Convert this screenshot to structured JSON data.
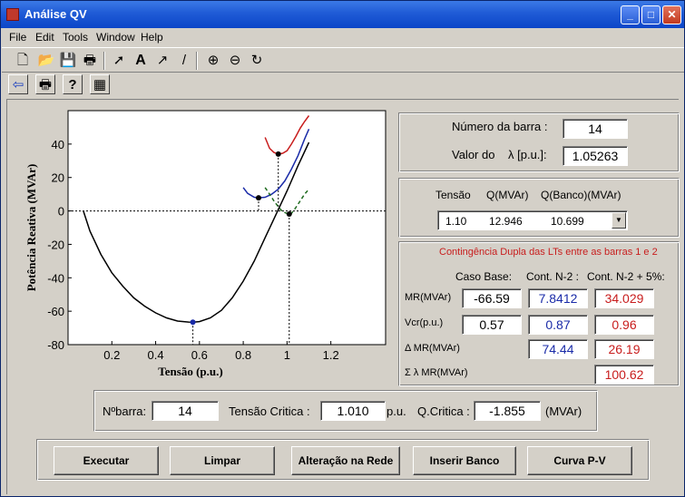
{
  "window": {
    "title": "Análise QV",
    "controls": {
      "minimize": "_",
      "maximize": "□",
      "close": "✕"
    }
  },
  "menu": [
    "File",
    "Edit",
    "Tools",
    "Window",
    "Help"
  ],
  "toolbar1": [
    "new-file-icon",
    "open-file-icon",
    "save-icon",
    "print-icon",
    "pointer-icon",
    "text-icon",
    "arrow-icon",
    "line-icon",
    "zoom-in-icon",
    "zoom-out-icon",
    "rotate-icon"
  ],
  "toolbar2": [
    "back-arrow-icon",
    "print-icon",
    "help-icon",
    "calculator-icon"
  ],
  "chart_data": {
    "type": "line",
    "xlabel": "Tensão (p.u.)",
    "ylabel": "Potência Reativa (MVAr)",
    "xlim": [
      0,
      1.45
    ],
    "ylim": [
      -80,
      60
    ],
    "xticks": [
      "0.2",
      "0.4",
      "0.6",
      "0.8",
      "1",
      "1.2"
    ],
    "yticks": [
      "-80",
      "-60",
      "-40",
      "-20",
      "0",
      "20",
      "40"
    ],
    "grid": false,
    "series": [
      {
        "color": "#000000",
        "x": [
          0.07,
          0.1,
          0.15,
          0.2,
          0.25,
          0.3,
          0.35,
          0.4,
          0.45,
          0.5,
          0.55,
          0.57,
          0.6,
          0.65,
          0.7,
          0.75,
          0.8,
          0.85,
          0.9,
          0.95,
          1.0,
          1.05,
          1.1
        ],
        "y": [
          0,
          -12,
          -26,
          -37,
          -45,
          -52,
          -57,
          -61,
          -64,
          -65.9,
          -66.5,
          -66.59,
          -66.2,
          -64,
          -59.5,
          -52,
          -42,
          -30,
          -16,
          -2,
          12,
          27,
          41
        ]
      },
      {
        "color": "#c81d1d",
        "x": [
          0.9,
          0.92,
          0.94,
          0.96,
          0.98,
          1.0,
          1.02,
          1.04,
          1.06,
          1.08,
          1.1
        ],
        "y": [
          44,
          37.5,
          35,
          34.03,
          34.5,
          36,
          40,
          44.5,
          49.5,
          53.5,
          57
        ]
      },
      {
        "color": "#1a2ba8",
        "x": [
          0.8,
          0.82,
          0.85,
          0.87,
          0.9,
          0.93,
          0.96,
          0.99,
          1.02,
          1.05,
          1.08,
          1.1
        ],
        "y": [
          14,
          10.5,
          8.2,
          7.84,
          8.2,
          10,
          13,
          18,
          25,
          33,
          43,
          49
        ]
      },
      {
        "color": "#1f6b1f",
        "dashed": true,
        "x": [
          0.9,
          0.92,
          0.94,
          0.96,
          0.98,
          1.0,
          1.01,
          1.02,
          1.04,
          1.06,
          1.08,
          1.1
        ],
        "y": [
          14,
          10,
          6,
          2.5,
          -0.5,
          -1.5,
          -1.855,
          -1.5,
          2,
          6,
          10,
          13
        ]
      }
    ],
    "markers": [
      {
        "x": 0.57,
        "y": -66.59,
        "color": "#1a2ba8"
      },
      {
        "x": 0.87,
        "y": 7.84,
        "color": "#000000"
      },
      {
        "x": 0.96,
        "y": 34.03,
        "color": "#000000"
      },
      {
        "x": 1.01,
        "y": -1.855,
        "color": "#000000"
      }
    ]
  },
  "panel_bar": {
    "numero_label": "Número da barra :",
    "numero_value": "14",
    "valor_label": "Valor do",
    "lambda_label": "λ [p.u.]:",
    "lambda_value": "1.05263"
  },
  "panel_table": {
    "headers": [
      "Tensão",
      "Q(MVAr)",
      "Q(Banco)(MVAr)"
    ],
    "selected": [
      "1.10",
      "12.946",
      "10.699"
    ]
  },
  "panel_cont": {
    "title": "Contingência Dupla das LTs entre as barras  1  e  2",
    "col_base": "Caso Base:",
    "col_n2": "Cont. N-2 :",
    "col_n2p": "Cont. N-2 + 5%:",
    "mr_label": "MR(MVAr)",
    "mr": [
      "-66.59",
      "7.8412",
      "34.029"
    ],
    "vcr_label": "Vcr(p.u.)",
    "vcr": [
      "0.57",
      "0.87",
      "0.96"
    ],
    "dmr_label": "Δ MR(MVAr)",
    "dmr": [
      "74.44",
      "26.19"
    ],
    "smr_label": "Σ λ MR(MVAr)",
    "smr": "100.62"
  },
  "panel_crit": {
    "nbarra_label": "Nºbarra:",
    "nbarra_value": "14",
    "tensao_label": "Tensão Critica :",
    "tensao_value": "1.010",
    "pu": "p.u.",
    "qcrit_label": "Q.Critica :",
    "qcrit_value": "-1.855",
    "mvar": "(MVAr)"
  },
  "buttons": [
    "Executar",
    "Limpar",
    "Alteração na Rede",
    "Inserir Banco",
    "Curva P-V"
  ]
}
